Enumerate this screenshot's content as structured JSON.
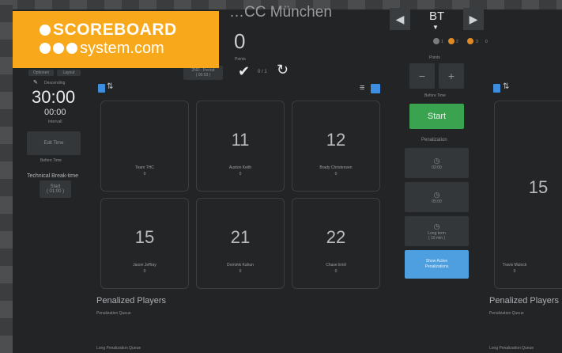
{
  "logo": {
    "line1": "SCOREBOARD",
    "line2": "system.com"
  },
  "header": {
    "title": "…CC München"
  },
  "timer": {
    "mode_label": "Descending",
    "main_time": "30:00",
    "sub_time": "00:00",
    "sub_label": "Intervall",
    "edit_label": "Edit Time",
    "before_time": "Before Time",
    "break_label": "Technical Break-time",
    "break_start": "Start",
    "break_duration": "( 01:00 )",
    "small_btn1": "Optionen",
    "small_btn2": "Layout"
  },
  "score": {
    "value": "0",
    "points_label": "Points",
    "period_label": "2ND - Period",
    "period_time": "( 00:53 )",
    "fraction": "0 / 1"
  },
  "right_panel": {
    "team_code": "BT",
    "dots": [
      "1",
      "2",
      "3",
      "0"
    ],
    "points_label": "Points",
    "minus": "−",
    "plus": "+",
    "before_time": "Before Time",
    "start_label": "Start",
    "penalization_label": "Penalization",
    "pen_times": [
      "02:00",
      "05:00"
    ],
    "long_label": "Long term",
    "long_time": "( 10 min )",
    "show_active_line1": "Show Active",
    "show_active_line2": "Penalizations"
  },
  "players": [
    {
      "number": "",
      "name": "Team THC",
      "points": "0"
    },
    {
      "number": "11",
      "name": "Auston Keith",
      "points": "0"
    },
    {
      "number": "12",
      "name": "Brady Christensen",
      "points": "0"
    },
    {
      "number": "15",
      "name": "Jason Jeffray",
      "points": "0"
    },
    {
      "number": "21",
      "name": "Dominik Kahun",
      "points": "0"
    },
    {
      "number": "22",
      "name": "Chase Emil",
      "points": "0"
    }
  ],
  "right_players": [
    {
      "number": "15",
      "name": "Travis Mulock",
      "points": "0"
    }
  ],
  "penalized": {
    "title": "Penalized Players",
    "queue_label": "Penalization Queue",
    "long_queue_label": "Long Penalization Queue"
  },
  "colors": {
    "accent_green": "#3aa350",
    "accent_blue": "#4d9fe0",
    "logo_orange": "#f7a81b",
    "dot_orange": "#e08a25"
  }
}
